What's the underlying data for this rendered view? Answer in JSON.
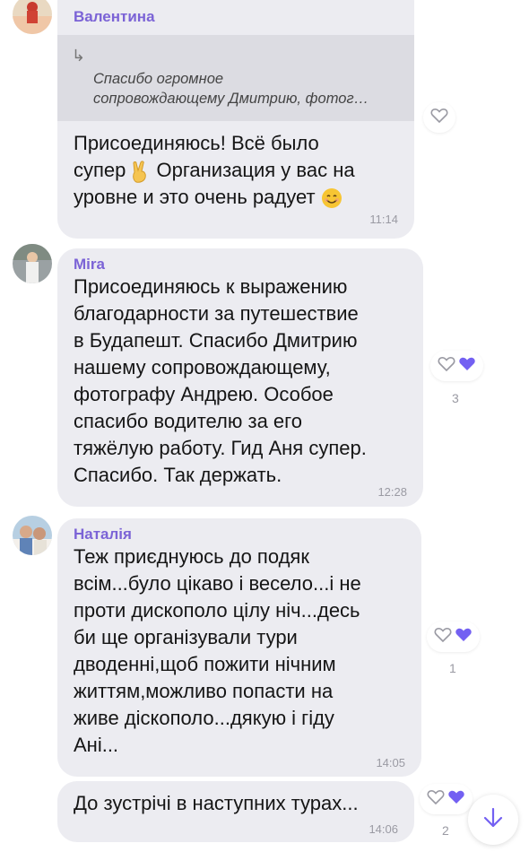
{
  "messages": [
    {
      "sender": "Валентина",
      "quote_text": "Спасибо огромное\nсопровождающему Дмитрию, фотог…",
      "text_line1": "Присоединяюсь! Всё было",
      "text_line2_a": "супер",
      "text_line2_b": " Организация у вас на",
      "text_line3": "уровне и это очень радует ",
      "time": "11:14"
    },
    {
      "sender": "Mira",
      "text": "Присоединяюсь к выражению\nблагодарности за путешествие\nв Будапешт. Спасибо Дмитрию\nнашему сопровождающему,\nфотографу Андрею. Особое\nспасибо водителю за его\nтяжёлую работу. Гид Аня супер.\nСпасибо. Так держать.",
      "time": "12:28",
      "like_count": "3"
    },
    {
      "sender": "Наталія",
      "text": "Теж приєднуюсь до подяк\nвсім...було цікаво і весело...і не\nпроти дискополо цілу ніч...десь\nби ще організували тури\nдводенні,щоб пожити нічним\nжиттям,можливо попасти на\nживе діскополо...дякую і гіду\nАні...",
      "time": "14:05",
      "like_count": "1"
    },
    {
      "text": "До зустрічі в наступних турах...",
      "time": "14:06",
      "like_count": "2"
    }
  ],
  "colors": {
    "accent": "#7b63d6",
    "bubble": "#ececf1",
    "quote_bg": "#dcdce2",
    "time": "#9a9aa3"
  },
  "icons": [
    "reply-arrow-icon",
    "heart-outline-icon",
    "heart-filled-icon",
    "scroll-down-arrow-icon",
    "victory-hand-emoji",
    "smile-emoji"
  ]
}
